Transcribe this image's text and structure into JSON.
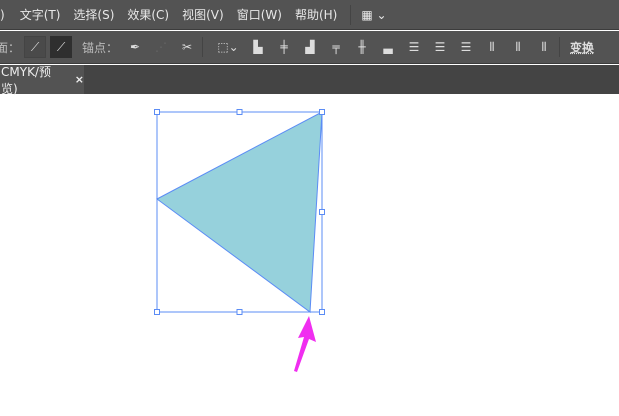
{
  "menu": [
    "文字(T)",
    "选择(S)",
    "效果(C)",
    "视图(V)",
    "窗口(W)",
    "帮助(H)"
  ],
  "menu_partial": ")",
  "control": {
    "left_label": "面：",
    "anchor_label": "锚点：",
    "transform_label": "变换"
  },
  "tab": {
    "title": "CMYK/预览)",
    "close": "×"
  },
  "colors": {
    "fill": "#96d1dc",
    "stroke": "#5b8cf5",
    "arrow": "#f02ef0"
  }
}
